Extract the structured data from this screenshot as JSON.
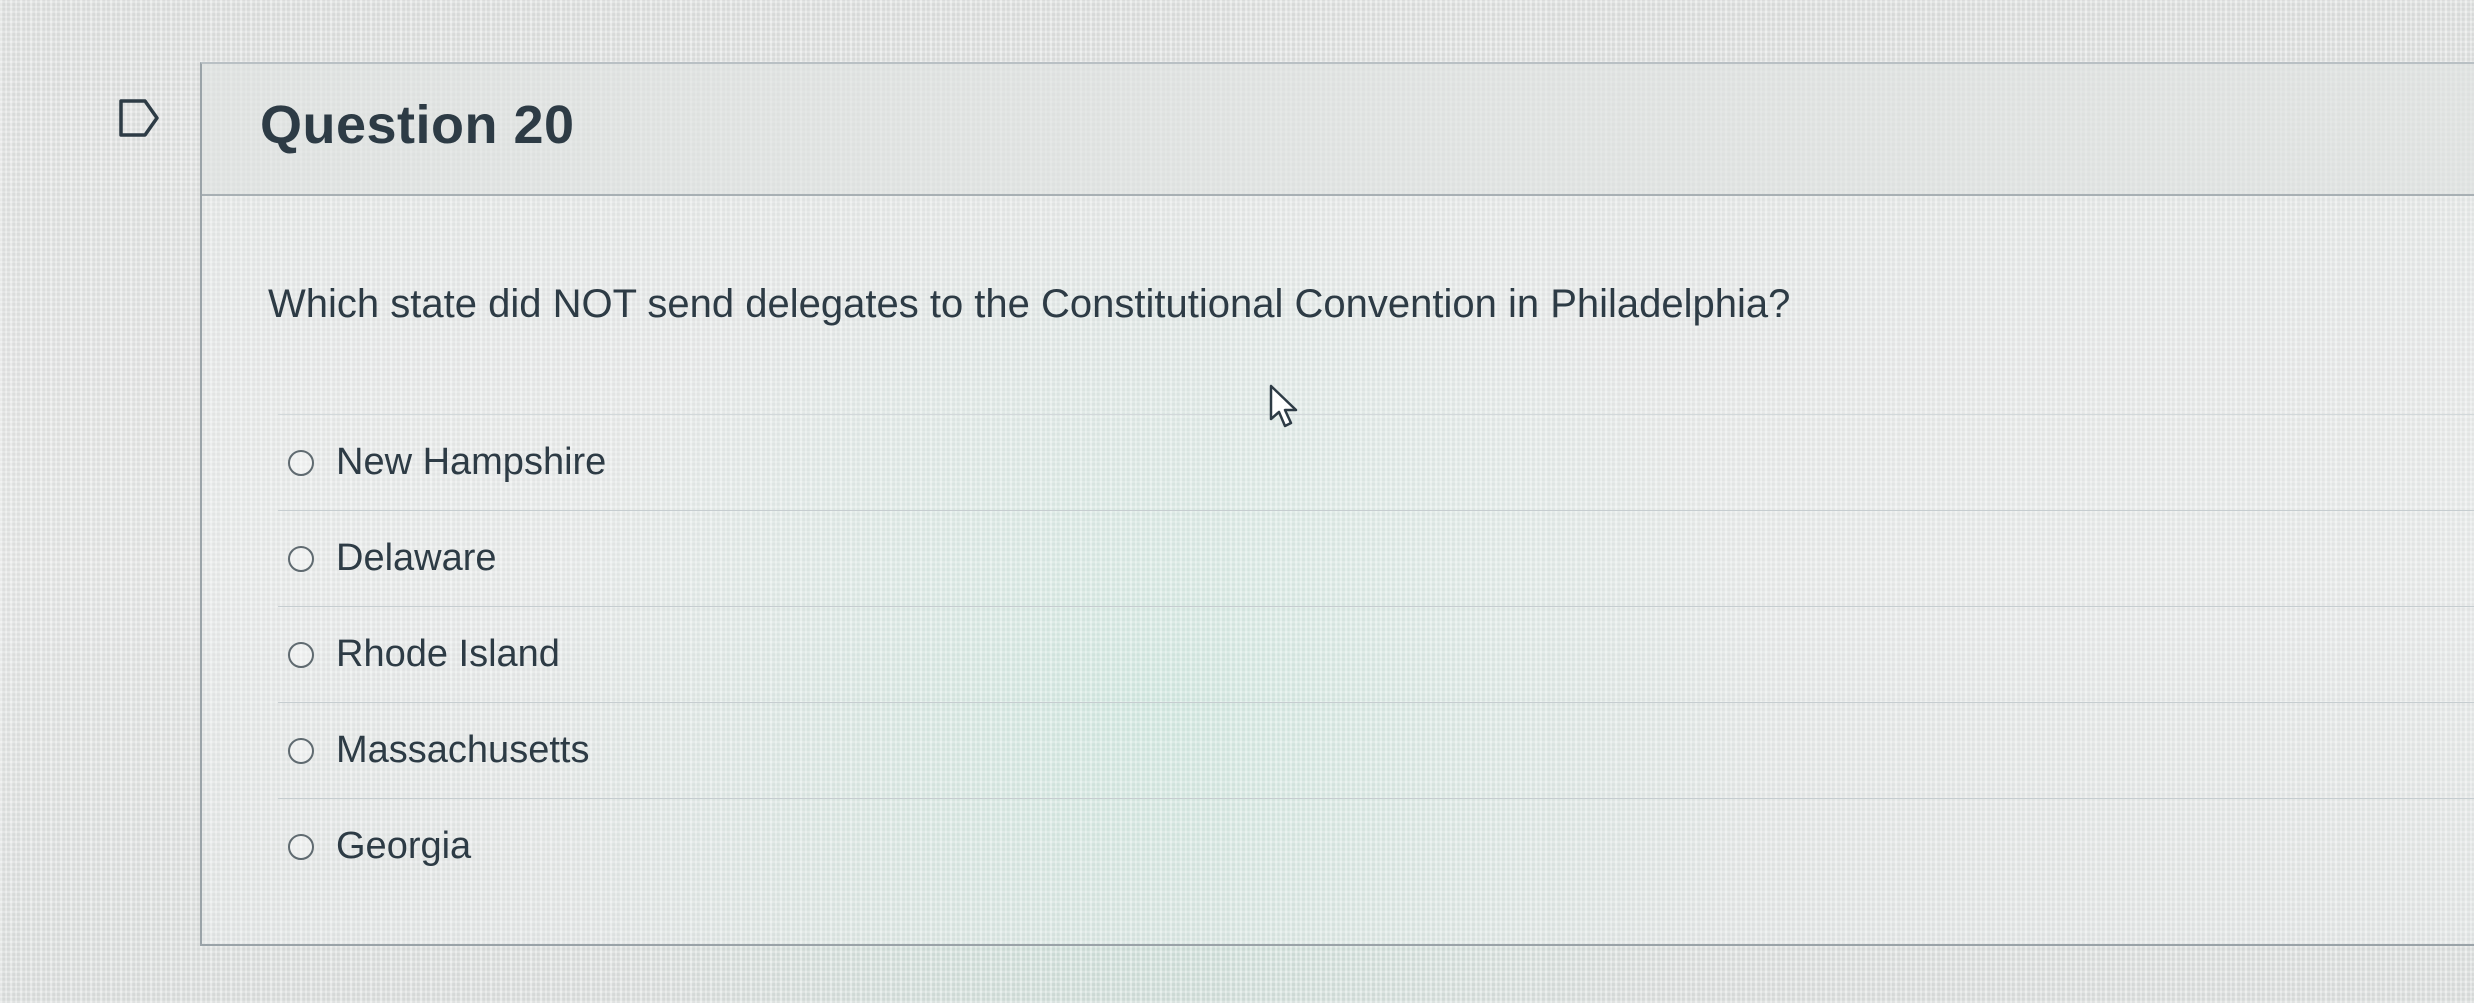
{
  "question": {
    "title": "Question 20",
    "text": "Which state did NOT send delegates to the Constitutional Convention in Philadelphia?",
    "answers": [
      {
        "label": "New Hampshire",
        "selected": false
      },
      {
        "label": "Delaware",
        "selected": false
      },
      {
        "label": "Rhode Island",
        "selected": false
      },
      {
        "label": "Massachusetts",
        "selected": false
      },
      {
        "label": "Georgia",
        "selected": false
      }
    ]
  },
  "icons": {
    "flag": "flag-icon",
    "cursor": "mouse-pointer-icon",
    "radio": "radio-button"
  },
  "colors": {
    "text": "#2d3b45",
    "border": "#9aa3a8"
  }
}
